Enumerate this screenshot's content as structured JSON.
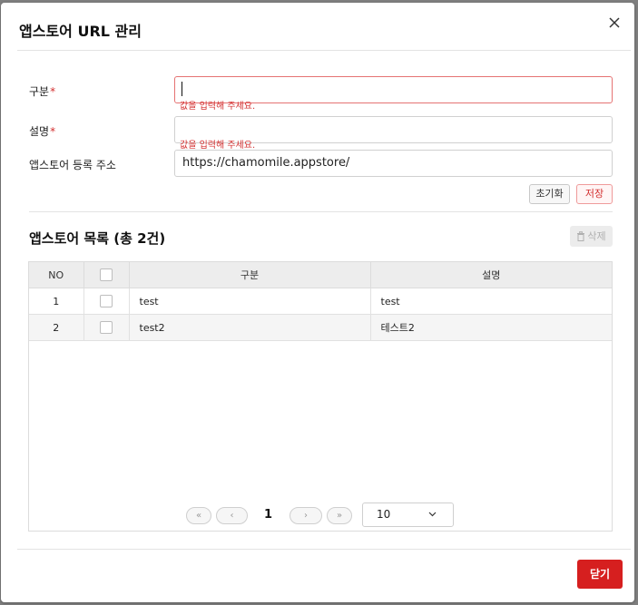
{
  "dialog": {
    "title": "앱스토어 URL 관리"
  },
  "form": {
    "category": {
      "label": "구분",
      "required_mark": "*",
      "value": "",
      "error": "값을 입력해 주세요."
    },
    "description": {
      "label": "설명",
      "required_mark": "*",
      "value": "",
      "error": "값을 입력해 주세요."
    },
    "url": {
      "label": "앱스토어 등록 주소",
      "value": "https://chamomile.appstore/"
    },
    "reset_label": "초기화",
    "save_label": "저장"
  },
  "list": {
    "title": "앱스토어 목록 (총 2건)",
    "delete_label": "삭제",
    "columns": [
      "NO",
      "",
      "구분",
      "설명"
    ],
    "rows": [
      {
        "no": "1",
        "category": "test",
        "description": "test"
      },
      {
        "no": "2",
        "category": "test2",
        "description": "테스트2"
      }
    ]
  },
  "pagination": {
    "first": "«",
    "prev": "‹",
    "current": "1",
    "next": "›",
    "last": "»",
    "page_size": "10"
  },
  "footer": {
    "close_label": "닫기"
  },
  "colors": {
    "primary_red": "#d61f1f",
    "error_red": "#d32f2f"
  }
}
